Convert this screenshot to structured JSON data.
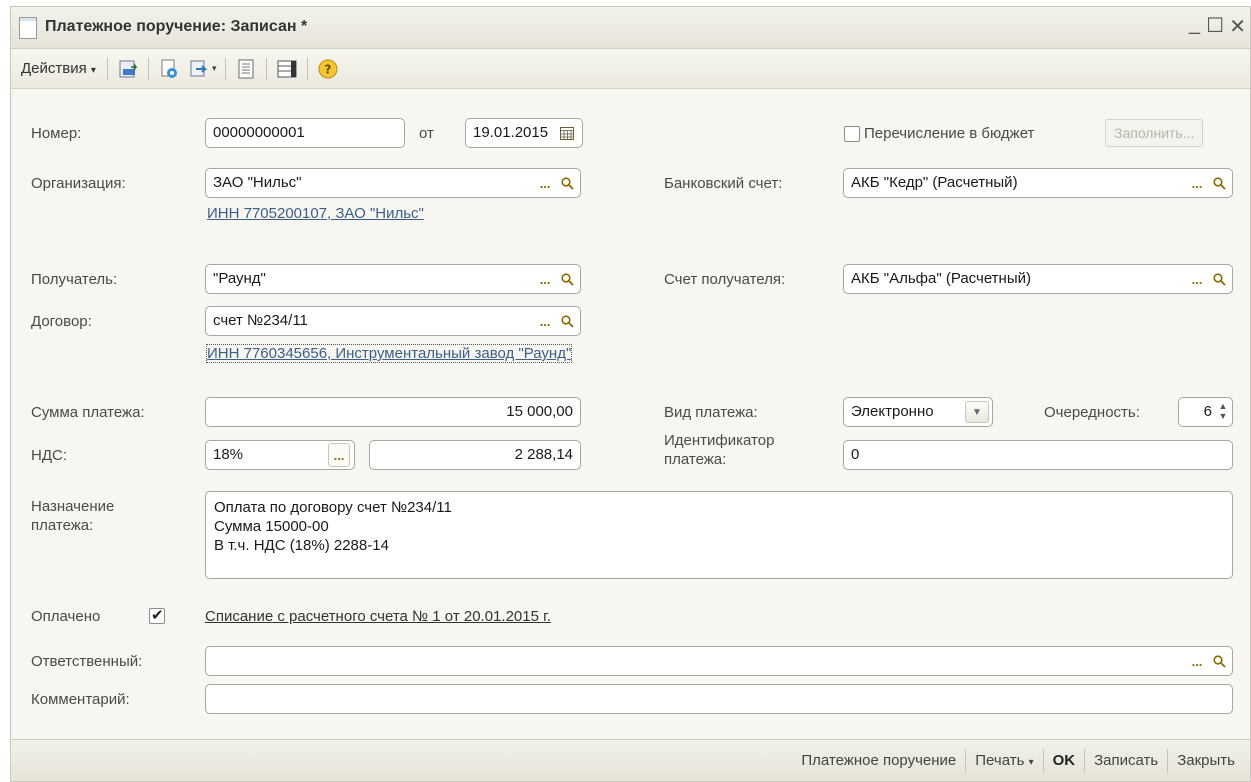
{
  "window": {
    "title": "Платежное поручение: Записан *",
    "minimize": "_",
    "maximize": "☐",
    "close": "✕"
  },
  "toolbar": {
    "actions_label": "Действия",
    "actions_arrow": "▾",
    "icons": [
      "post-document-icon",
      "copy-document-icon",
      "navigate-icon",
      "journal-icon",
      "list-icon",
      "help-icon"
    ]
  },
  "form": {
    "number": {
      "label": "Номер:",
      "value": "00000000001"
    },
    "date": {
      "label": "от",
      "value": "19.01.2015"
    },
    "budget": {
      "label": "Перечисление в бюджет",
      "checked": false,
      "fill_button": "Заполнить..."
    },
    "organization": {
      "label": "Организация:",
      "value": "ЗАО \"Нильс\"",
      "link": "ИНН 7705200107, ЗАО \"Нильс\""
    },
    "bank_account": {
      "label": "Банковский счет:",
      "value": "АКБ \"Кедр\" (Расчетный)"
    },
    "recipient": {
      "label": "Получатель:",
      "value": "\"Раунд\""
    },
    "recipient_account": {
      "label": "Счет получателя:",
      "value": "АКБ \"Альфа\" (Расчетный)"
    },
    "contract": {
      "label": "Договор:",
      "value": "счет №234/11",
      "link": "ИНН 7760345656, Инструментальный завод \"Раунд\""
    },
    "amount": {
      "label": "Сумма платежа:",
      "value": "15 000,00"
    },
    "payment_type": {
      "label": "Вид платежа:",
      "value": "Электронно"
    },
    "priority": {
      "label": "Очередность:",
      "value": "6"
    },
    "vat": {
      "label": "НДС:",
      "rate": "18%",
      "amount": "2 288,14"
    },
    "payment_id": {
      "label_line1": "Идентификатор",
      "label_line2": "платежа:",
      "value": "0"
    },
    "purpose": {
      "label_line1": "Назначение",
      "label_line2": "платежа:",
      "lines": [
        "Оплата по договору счет №234/11",
        "Сумма 15000-00",
        "В т.ч. НДС  (18%) 2288-14"
      ]
    },
    "paid": {
      "label": "Оплачено",
      "checked": true,
      "link": "Списание с расчетного счета № 1 от 20.01.2015 г."
    },
    "responsible": {
      "label": "Ответственный:",
      "value": ""
    },
    "comment": {
      "label": "Комментарий:",
      "value": ""
    }
  },
  "footer": {
    "payment_order": "Платежное поручение",
    "print": "Печать",
    "print_arrow": "▾",
    "ok": "OK",
    "save": "Записать",
    "close": "Закрыть"
  },
  "colors": {
    "link": "#3b5e8f",
    "window_bg": "#f7f6f0",
    "field_border": "#a7a7a0"
  }
}
